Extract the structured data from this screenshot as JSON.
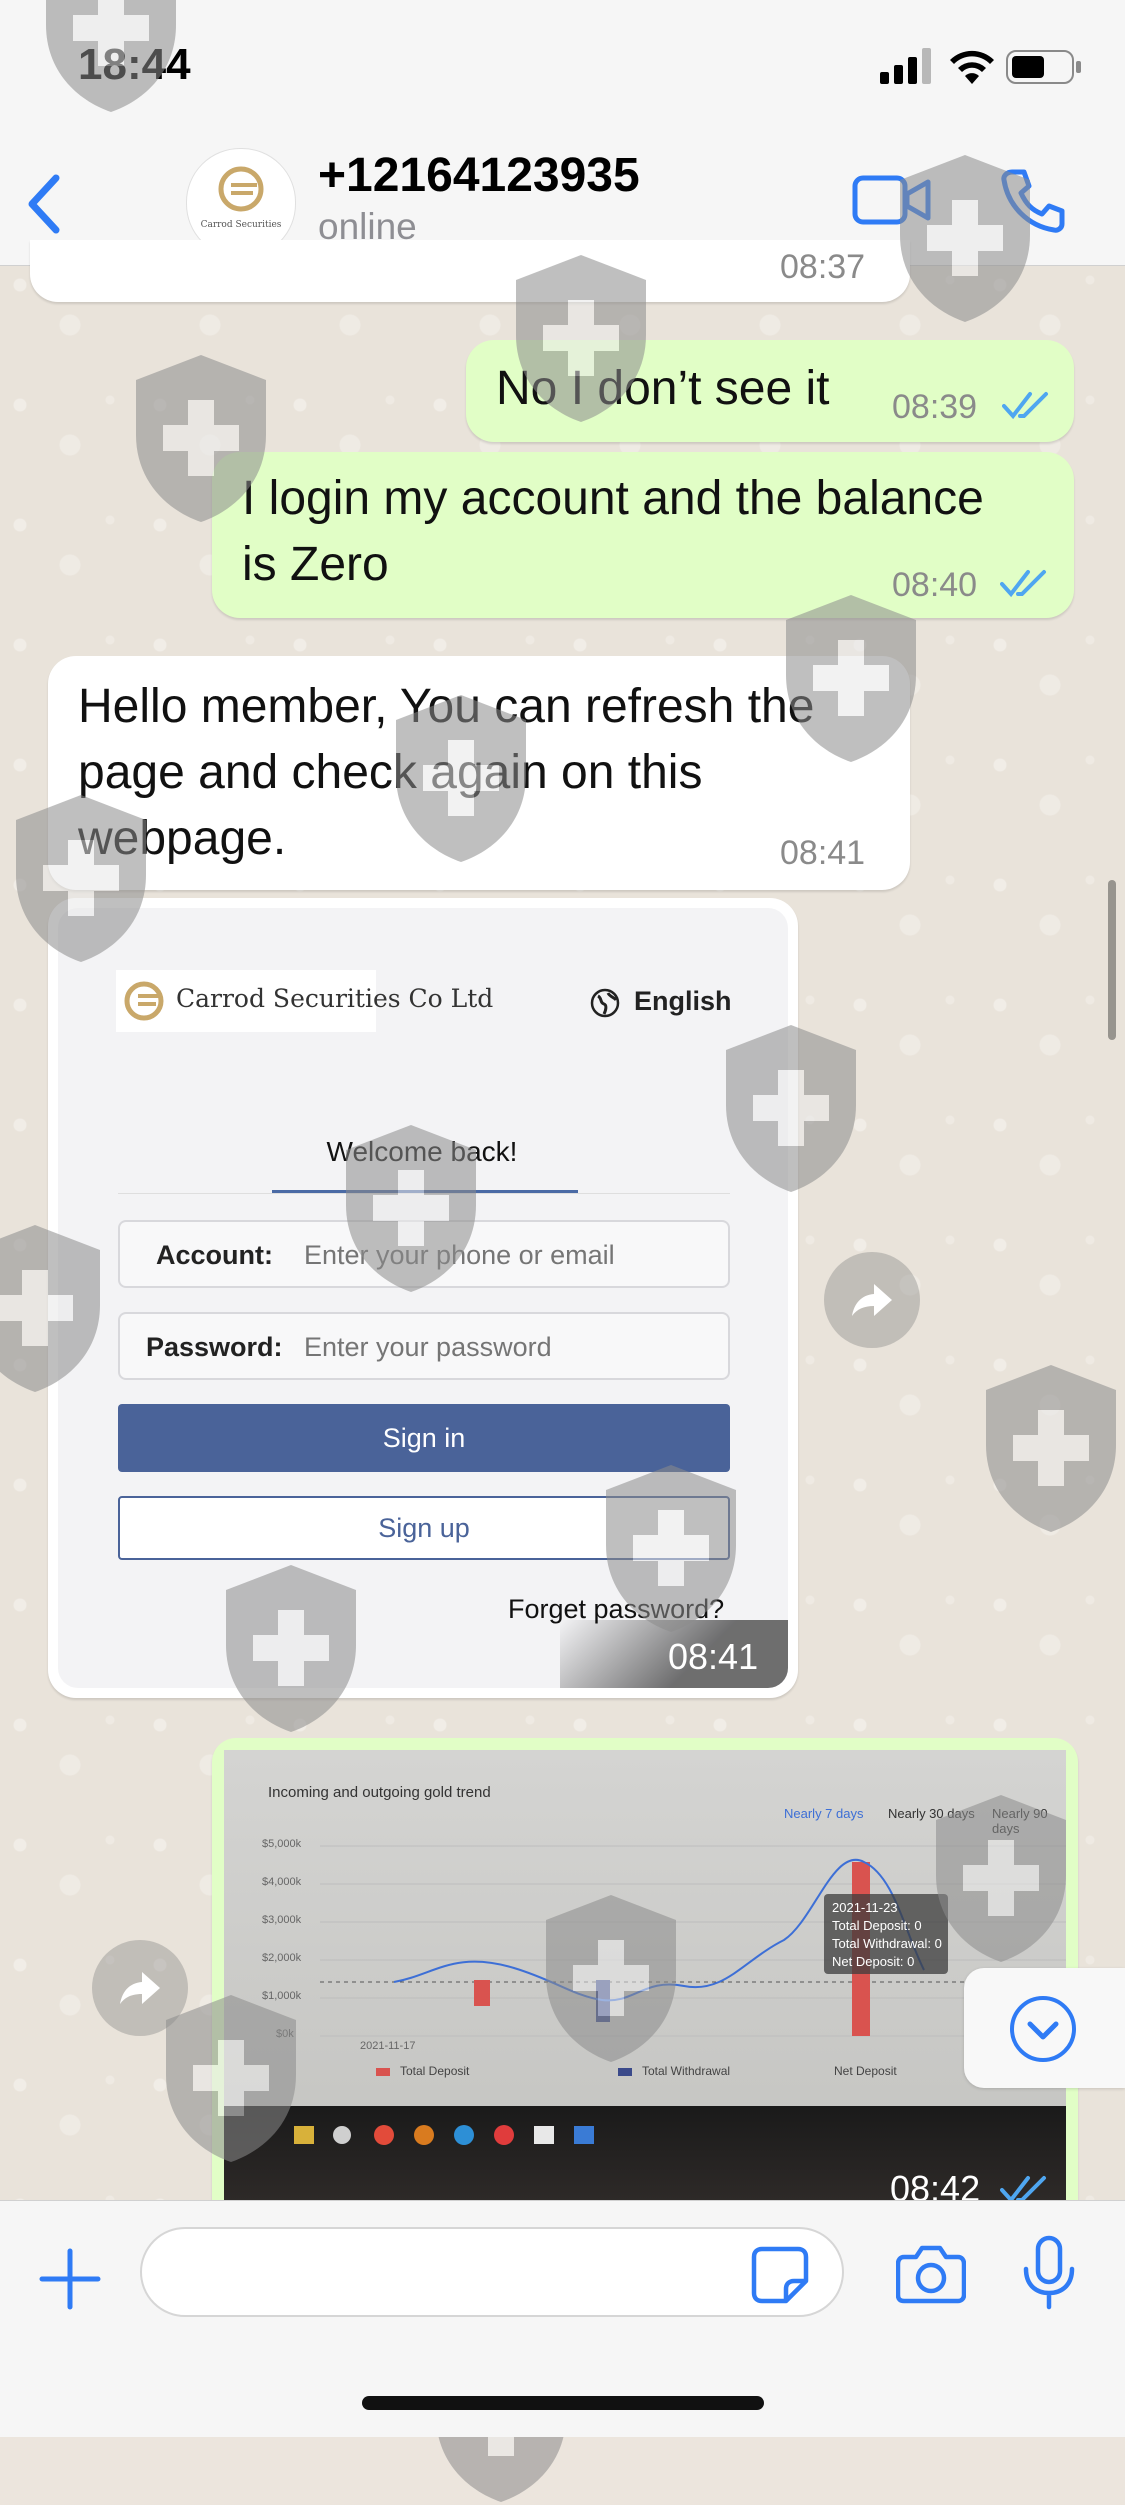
{
  "status_bar": {
    "time": "18:44"
  },
  "header": {
    "contact_name": "+12164123935",
    "contact_status": "online",
    "avatar_text": "Carrod Securities"
  },
  "messages": [
    {
      "direction": "in",
      "text": "",
      "time": "08:37"
    },
    {
      "direction": "out",
      "text": "No I don’t see it",
      "time": "08:39",
      "read": true
    },
    {
      "direction": "out",
      "text_lines": [
        "I login my account and the balance",
        "is Zero"
      ],
      "time": "08:40",
      "read": true
    },
    {
      "direction": "in",
      "text_lines": [
        "Hello member, You can refresh the",
        "page and check again on this",
        "webpage."
      ],
      "time": "08:41"
    }
  ],
  "login_image": {
    "brand_name": "Carrod Securities Co Ltd",
    "language": "English",
    "welcome": "Welcome back!",
    "account_label": "Account:",
    "account_placeholder": "Enter your phone or email",
    "password_label": "Password:",
    "password_placeholder": "Enter your password",
    "sign_in": "Sign in",
    "sign_up": "Sign up",
    "forget_password": "Forget password?",
    "time": "08:41"
  },
  "chart_image": {
    "time": "08:42",
    "read": true
  },
  "chart_data": {
    "type": "line",
    "title": "Incoming and outgoing gold trend",
    "range_tabs": [
      "Nearly 7 days",
      "Nearly 30 days",
      "Nearly 90 days"
    ],
    "selected_range": "Nearly 7 days",
    "y_ticks": [
      "$5,000k",
      "$4,000k",
      "$3,000k",
      "$2,000k",
      "$1,000k",
      "$0k"
    ],
    "ylim": [
      0,
      5000
    ],
    "x_first_label": "2021-11-17",
    "series": [
      {
        "name": "Total Deposit",
        "kind": "bar",
        "color": "#d9534f"
      },
      {
        "name": "Total Withdrawal",
        "kind": "bar",
        "color": "#3b4a8a"
      },
      {
        "name": "Net Deposit",
        "kind": "line",
        "color": "#3d6fd6"
      }
    ],
    "tooltip": {
      "date": "2021-11-23",
      "lines": [
        "Total Deposit: 0",
        "Total Withdrawal: 0",
        "Net Deposit: 0"
      ]
    }
  },
  "colors": {
    "accent": "#2f7bf5",
    "outgoing_bubble": "#e1fec6",
    "incoming_bubble": "#ffffff",
    "read_ticks": "#4fa6f0"
  },
  "icons": [
    "back-icon",
    "video-call-icon",
    "phone-icon",
    "double-check-icon",
    "forward-icon",
    "globe-icon",
    "chevron-down-icon",
    "plus-icon",
    "sticker-icon",
    "camera-icon",
    "microphone-icon"
  ]
}
